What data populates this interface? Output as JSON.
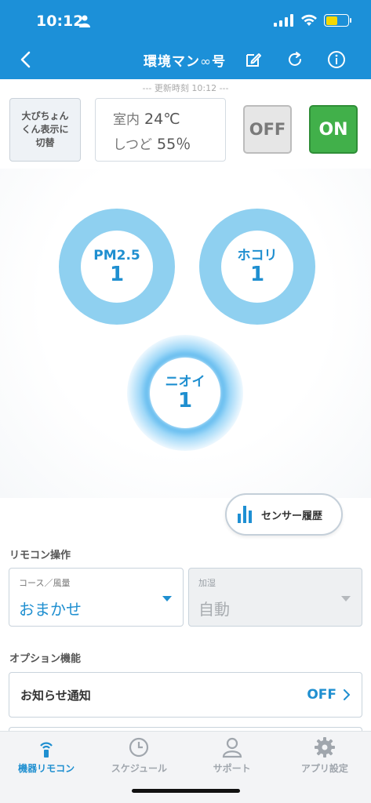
{
  "status_bar": {
    "time": "10:12"
  },
  "nav": {
    "title_prefix": "環境マン",
    "title_glyph": "∞",
    "title_suffix": "号"
  },
  "updated_text": "--- 更新時刻 10:12 ---",
  "controls": {
    "switch_view_label": "大ぴちょんくん表示に切替",
    "temperature_label": "室内",
    "temperature_value": "24℃",
    "humidity_label": "しつど",
    "humidity_value": "55％",
    "off_label": "OFF",
    "on_label": "ON"
  },
  "sensors": [
    {
      "name": "PM2.5",
      "value": "1"
    },
    {
      "name": "ホコリ",
      "value": "1"
    },
    {
      "name": "ニオイ",
      "value": "1"
    }
  ],
  "history_button": "センサー履歴",
  "remote": {
    "section_title": "リモコン操作",
    "course_caption": "コース／風量",
    "course_value": "おまかせ",
    "humidify_caption": "加湿",
    "humidify_value": "自動"
  },
  "options": {
    "section_title": "オプション機能",
    "notify_label": "お知らせ通知",
    "notify_state": "OFF"
  },
  "tabs": [
    {
      "label": "機器リモコン",
      "active": true
    },
    {
      "label": "スケジュール",
      "active": false
    },
    {
      "label": "サポート",
      "active": false
    },
    {
      "label": "アプリ設定",
      "active": false
    }
  ],
  "colors": {
    "header": "#1c90d8",
    "accent": "#1f8fd0",
    "on_button": "#41b04a",
    "sensor_ring": "#8fd0f0"
  }
}
